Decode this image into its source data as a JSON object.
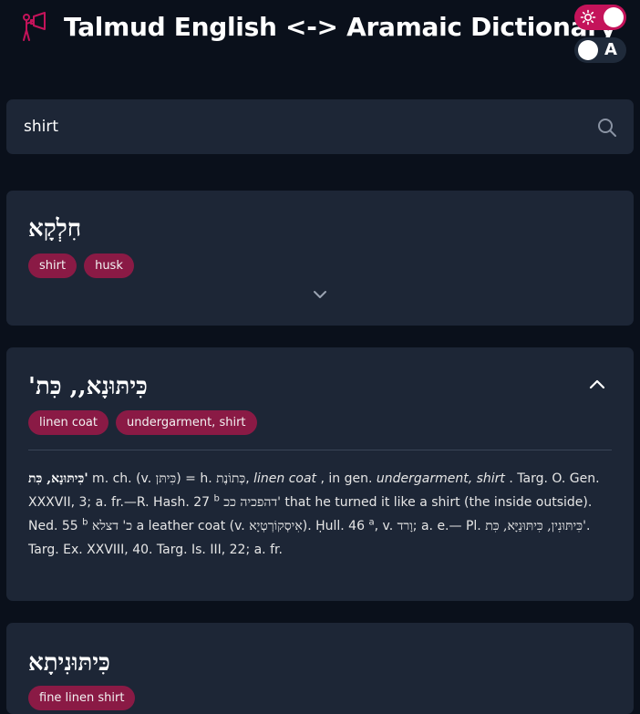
{
  "app": {
    "title": "Talmud English <-> Aramaic Dictionary",
    "logo_icon": "megaphone-person-icon",
    "theme_toggle": {
      "icon": "sun-icon",
      "state": "on",
      "color": "#c4135a"
    },
    "font_toggle": {
      "letter": "A",
      "state": "off"
    }
  },
  "search": {
    "value": "shirt",
    "icon": "search-icon"
  },
  "results": [
    {
      "word": "חִלְקָא",
      "tags": [
        "shirt",
        "husk"
      ],
      "expanded": false
    },
    {
      "word": "כִּיתּוּנָא,, כִּת'",
      "tags": [
        "linen coat",
        "undergarment, shirt"
      ],
      "expanded": true,
      "definition": {
        "w1": "כִּיתּוּנָא, כִּת'",
        "t1": " m. ch. (v. ",
        "h1": "כִּיתּן",
        "t2": ") = h. ",
        "h2": "כְּתוֹנֶת",
        "t3": ", ",
        "i1": "linen coat",
        "t4": " , in gen. ",
        "i2": "undergarment, shirt",
        "t5": " . Targ. O. Gen. XXXVII, 3; a. fr.—R. Hash. 27 ",
        "s1": "b",
        "t6": " ",
        "h3": "דהפכיה ככ'",
        "t7": " that he turned it like a shirt (the inside outside). Ned. 55 ",
        "s2": "b",
        "t8": " ",
        "h4": "כ' דצלא",
        "t9": " a leather coat (v. ",
        "h5": "אִיסְקוֹרְטְיָא",
        "t10": "). Ḥull. 46 ",
        "s3": "a",
        "t11": ", v. ",
        "h6": "וָרד",
        "t12": "; a. e.— Pl. ",
        "h7": "כִּיתּוּנִין, כִּיתּוּנַיָּא, כִּת'",
        "t13": ". Targ. Ex. XXVIII, 40. Targ. Is. III, 22; a. fr."
      }
    },
    {
      "word": "כִּיתּוּנִיתָא",
      "tags": [
        "fine linen shirt"
      ],
      "expanded": false
    }
  ],
  "colors": {
    "background": "#0a101b",
    "card": "#1d2636",
    "tag": "#8a1a45",
    "accent": "#c4135a"
  }
}
